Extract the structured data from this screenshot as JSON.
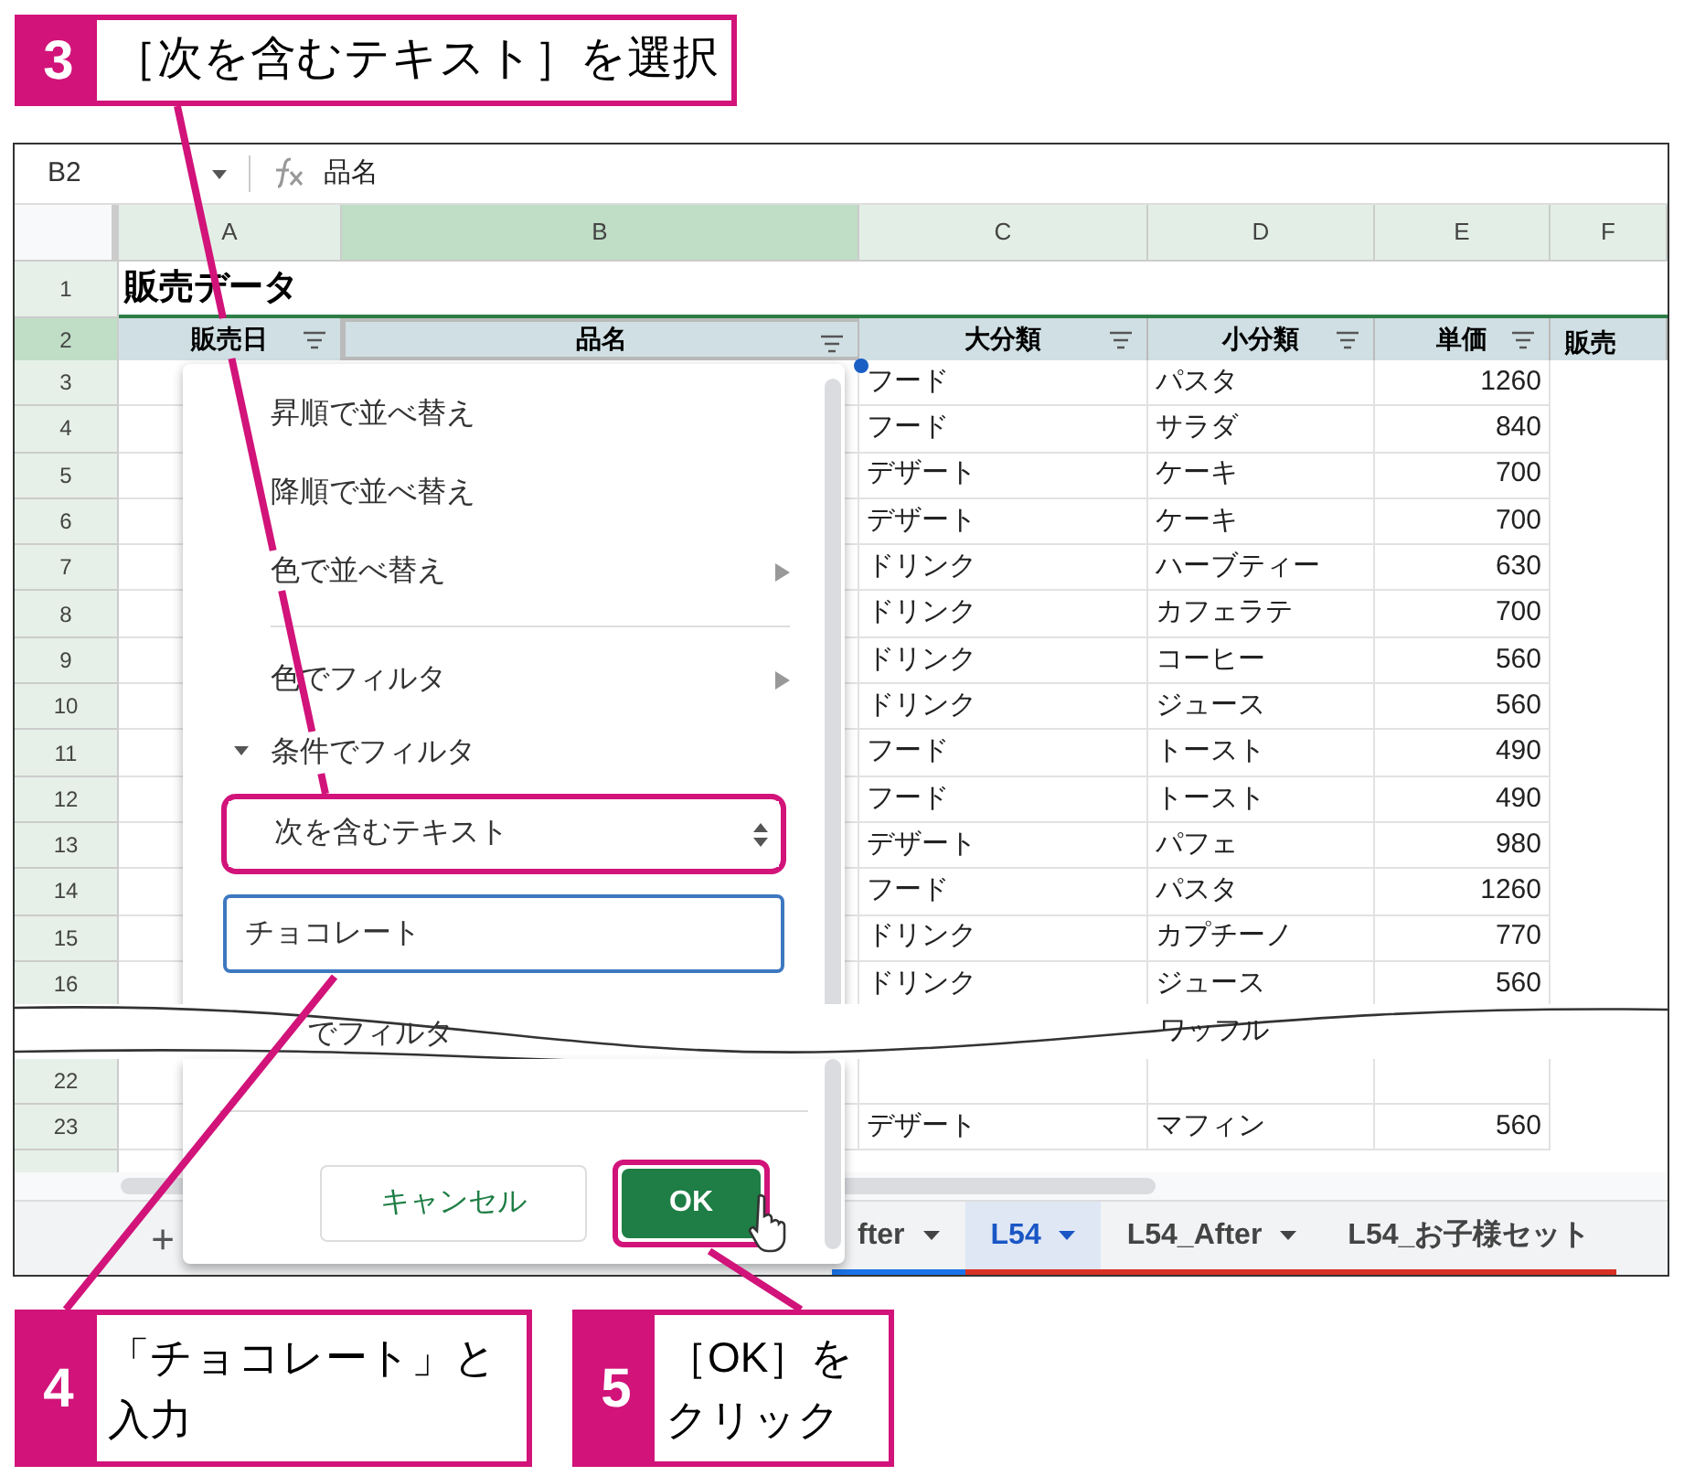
{
  "callouts": [
    {
      "number": "3",
      "text": "［次を含むテキスト］を選択"
    },
    {
      "number": "4",
      "lines": [
        "「チョコレート」と",
        "入力"
      ]
    },
    {
      "number": "5",
      "lines": [
        "［OK］を",
        "クリック"
      ]
    }
  ],
  "formula_bar": {
    "cell_ref": "B2",
    "content": "品名"
  },
  "columns": [
    {
      "label": "A",
      "selected": false
    },
    {
      "label": "B",
      "selected": true
    },
    {
      "label": "C",
      "selected": false
    },
    {
      "label": "D",
      "selected": false
    },
    {
      "label": "E",
      "selected": false
    },
    {
      "label": "F",
      "selected": false
    }
  ],
  "title_row": {
    "number": "1",
    "title": "販売データ"
  },
  "header_row": {
    "number": "2",
    "cells": [
      "販売日",
      "品名",
      "大分類",
      "小分類",
      "単価",
      "販売"
    ]
  },
  "rows": [
    {
      "number": "3",
      "cells": [
        "フード",
        "パスタ",
        "1260"
      ]
    },
    {
      "number": "4",
      "cells": [
        "フード",
        "サラダ",
        "840"
      ]
    },
    {
      "number": "5",
      "cells": [
        "デザート",
        "ケーキ",
        "700"
      ]
    },
    {
      "number": "6",
      "cells": [
        "デザート",
        "ケーキ",
        "700"
      ]
    },
    {
      "number": "7",
      "cells": [
        "ドリンク",
        "ハーブティー",
        "630"
      ]
    },
    {
      "number": "8",
      "cells": [
        "ドリンク",
        "カフェラテ",
        "700"
      ]
    },
    {
      "number": "9",
      "cells": [
        "ドリンク",
        "コーヒー",
        "560"
      ]
    },
    {
      "number": "10",
      "cells": [
        "ドリンク",
        "ジュース",
        "560"
      ]
    },
    {
      "number": "11",
      "cells": [
        "フード",
        "トースト",
        "490"
      ]
    },
    {
      "number": "12",
      "cells": [
        "フード",
        "トースト",
        "490"
      ]
    },
    {
      "number": "13",
      "cells": [
        "デザート",
        "パフェ",
        "980"
      ]
    },
    {
      "number": "14",
      "cells": [
        "フード",
        "パスタ",
        "1260"
      ]
    },
    {
      "number": "15",
      "cells": [
        "ドリンク",
        "カプチーノ",
        "770"
      ]
    },
    {
      "number": "16",
      "cells": [
        "ドリンク",
        "ジュース",
        "560"
      ]
    }
  ],
  "break_row": {
    "column_4": "ワッフル"
  },
  "lower_rows": [
    {
      "number": "22"
    },
    {
      "number": "23",
      "cells": [
        "デザート",
        "マフィン",
        "560"
      ]
    }
  ],
  "filter_menu": {
    "items": [
      {
        "kind": "item",
        "label": "昇順で並べ替え"
      },
      {
        "kind": "item",
        "label": "降順で並べ替え"
      },
      {
        "kind": "submenu",
        "label": "色で並べ替え"
      },
      {
        "kind": "divider"
      },
      {
        "kind": "submenu",
        "label": "色でフィルタ"
      },
      {
        "kind": "section",
        "label": "条件でフィルタ",
        "expanded": true
      }
    ],
    "condition": {
      "value": "次を含むテキスト"
    },
    "value_field": {
      "value": "チョコレート"
    },
    "partial_item": "でフィルタ",
    "buttons": [
      {
        "kind": "secondary",
        "label": "キャンセル"
      },
      {
        "kind": "primary",
        "label": "OK"
      }
    ]
  },
  "sheet_tabs": {
    "add": "+",
    "tabs": [
      {
        "label": "fter",
        "selected": false,
        "caret": true,
        "color": "#1a73e8"
      },
      {
        "label": "L54",
        "selected": true,
        "caret": true,
        "color": "#d93025"
      },
      {
        "label": "L54_After",
        "selected": false,
        "caret": true,
        "color": "#d93025"
      },
      {
        "label": "L54_お子様セット",
        "selected": false,
        "caret": false,
        "color": "#d93025"
      }
    ]
  }
}
